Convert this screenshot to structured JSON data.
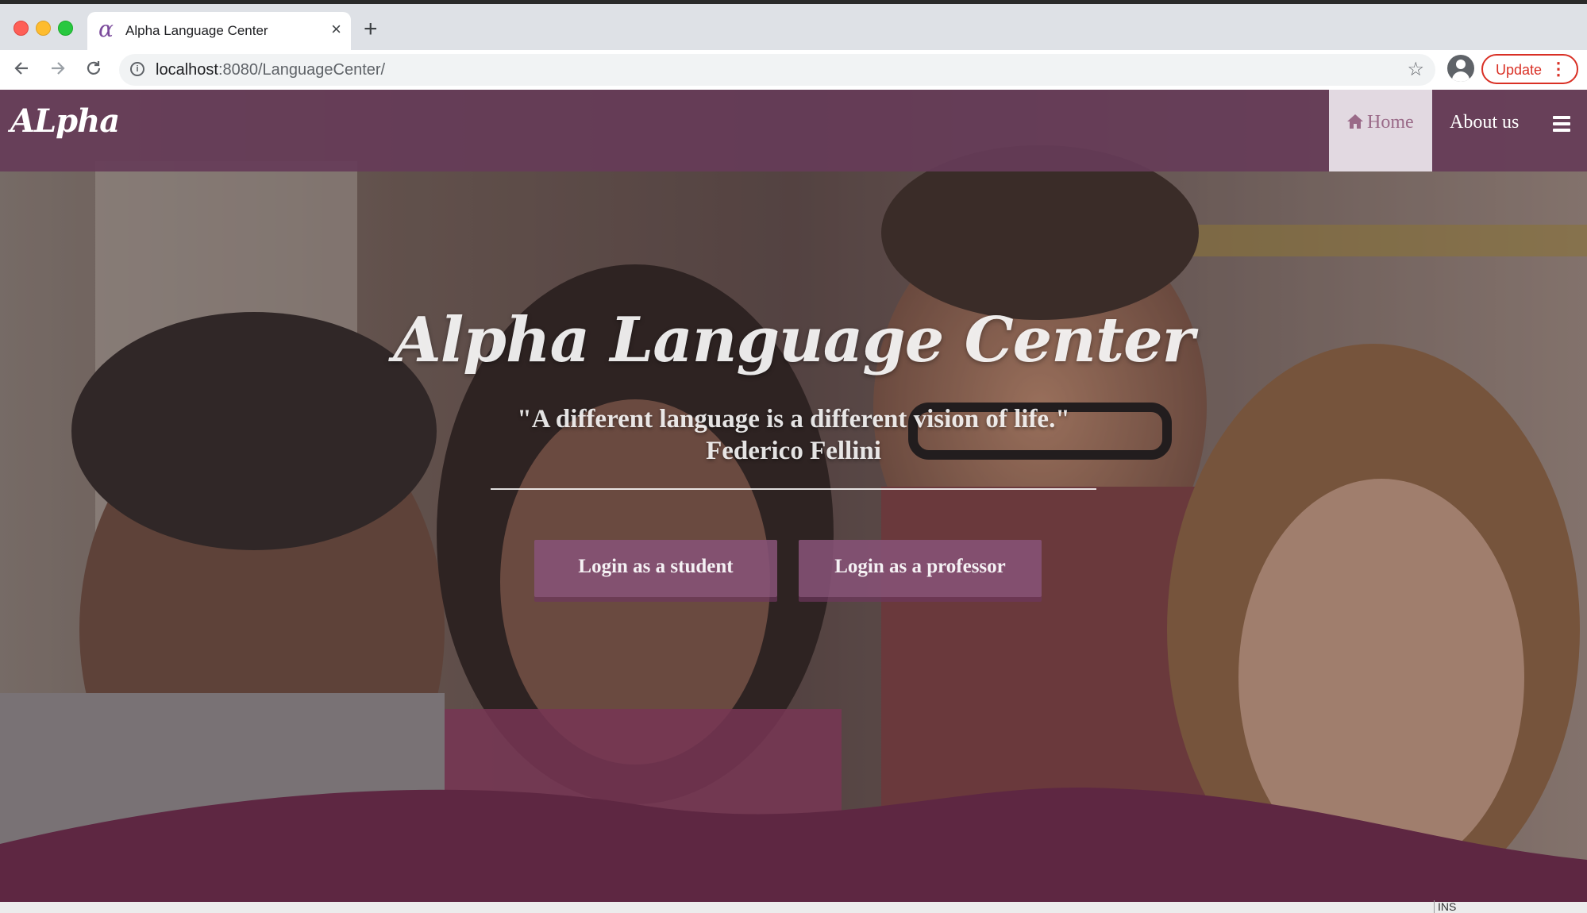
{
  "browser": {
    "tab_title": "Alpha Language Center",
    "tab_favicon": "α",
    "new_tab_symbol": "+",
    "close_symbol": "×",
    "url_host": "localhost",
    "url_path": ":8080/LanguageCenter/",
    "update_label": "Update",
    "icons": [
      "back-icon",
      "forward-icon",
      "reload-icon",
      "info-icon",
      "star-icon",
      "profile-icon",
      "kebab-icon"
    ]
  },
  "site": {
    "brand": "ALpha",
    "nav": {
      "home_label": "Home",
      "about_label": "About us",
      "home_icon": "home-icon",
      "menu_icon": "hamburger-icon"
    },
    "hero": {
      "title": "Alpha Language Center",
      "quote": "\"A different language is a different vision of life.\"",
      "author": "Federico Fellini",
      "student_button": "Login as a student",
      "professor_button": "Login as a professor"
    },
    "colors": {
      "primary": "#663c58",
      "wave": "#5e2742",
      "button": "#865276",
      "home_active_bg": "#e2d9e1"
    }
  },
  "status": {
    "ins": "INS"
  }
}
